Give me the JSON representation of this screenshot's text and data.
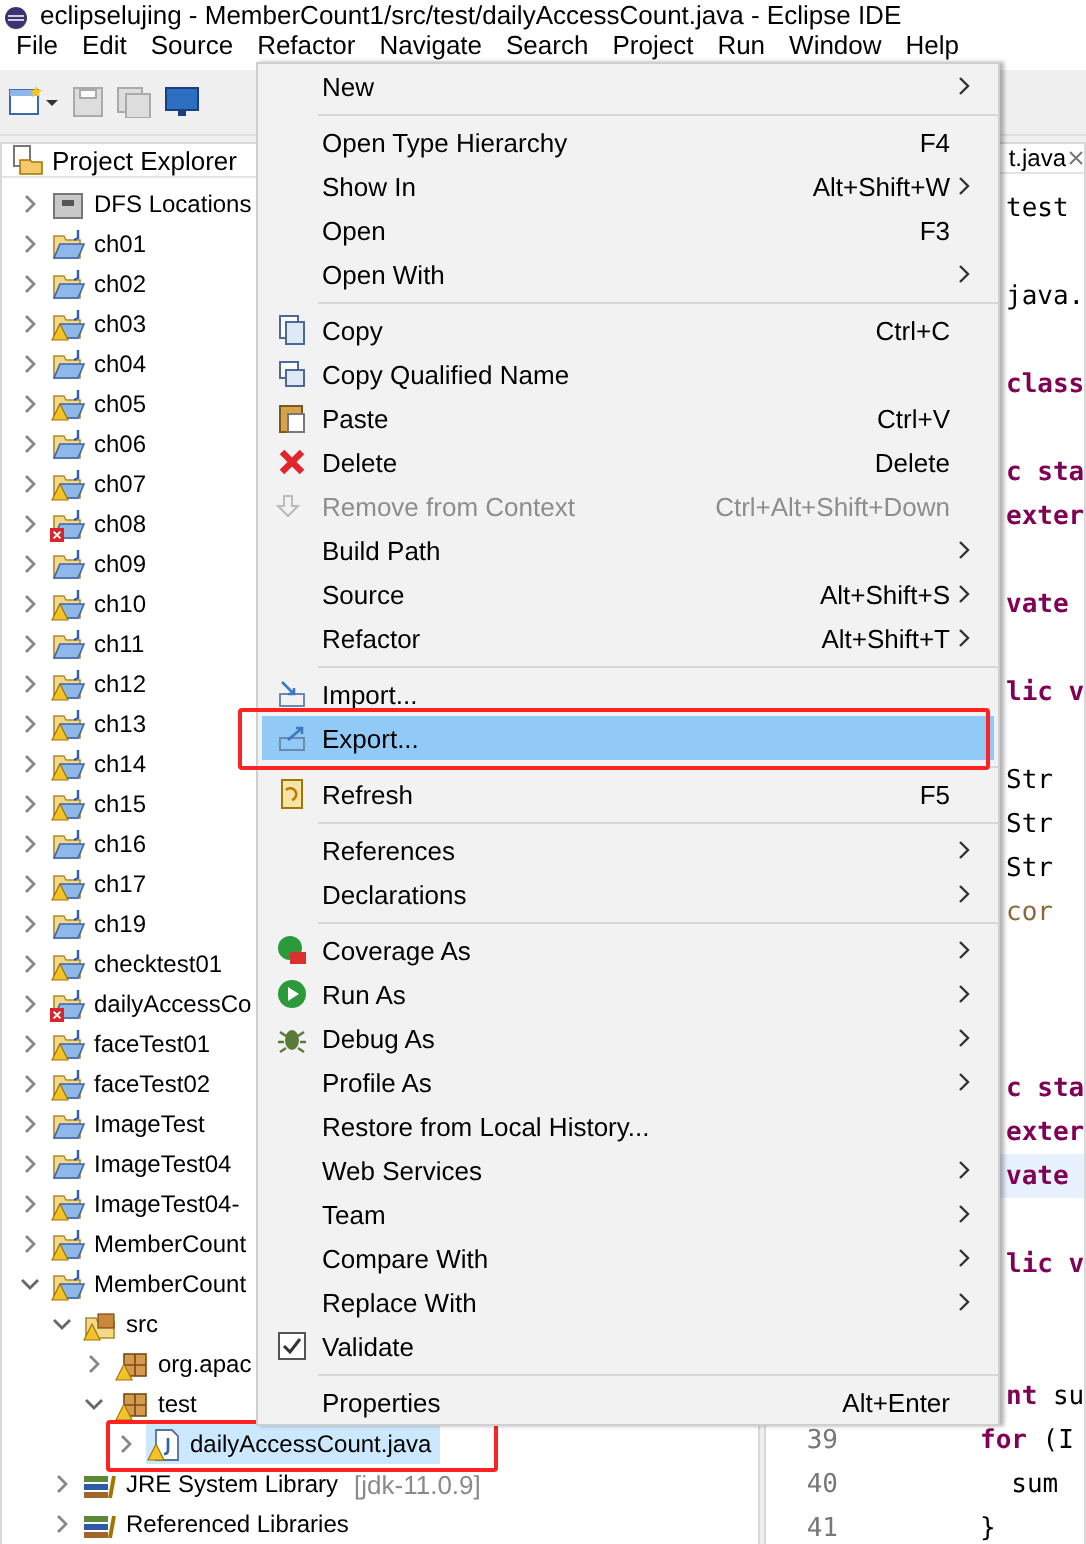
{
  "window": {
    "title": "eclipselujing - MemberCount1/src/test/dailyAccessCount.java - Eclipse IDE"
  },
  "menu_bar": [
    "File",
    "Edit",
    "Source",
    "Refactor",
    "Navigate",
    "Search",
    "Project",
    "Run",
    "Window",
    "Help"
  ],
  "explorer": {
    "title": "Project Explorer",
    "items": [
      {
        "label": "DFS Locations",
        "kind": "dfs",
        "warning": false,
        "error": false,
        "expanded": false,
        "selected": false,
        "outlined": false
      },
      {
        "label": "ch01",
        "kind": "project",
        "warning": false,
        "error": false,
        "expanded": false,
        "selected": false,
        "outlined": false
      },
      {
        "label": "ch02",
        "kind": "project",
        "warning": false,
        "error": false,
        "expanded": false,
        "selected": false,
        "outlined": false
      },
      {
        "label": "ch03",
        "kind": "project",
        "warning": true,
        "error": false,
        "expanded": false,
        "selected": false,
        "outlined": false
      },
      {
        "label": "ch04",
        "kind": "project",
        "warning": false,
        "error": false,
        "expanded": false,
        "selected": false,
        "outlined": false
      },
      {
        "label": "ch05",
        "kind": "project",
        "warning": true,
        "error": false,
        "expanded": false,
        "selected": false,
        "outlined": false
      },
      {
        "label": "ch06",
        "kind": "project",
        "warning": false,
        "error": false,
        "expanded": false,
        "selected": false,
        "outlined": false
      },
      {
        "label": "ch07",
        "kind": "project",
        "warning": true,
        "error": false,
        "expanded": false,
        "selected": false,
        "outlined": false
      },
      {
        "label": "ch08",
        "kind": "project",
        "warning": false,
        "error": true,
        "expanded": false,
        "selected": false,
        "outlined": false
      },
      {
        "label": "ch09",
        "kind": "project",
        "warning": false,
        "error": false,
        "expanded": false,
        "selected": false,
        "outlined": false
      },
      {
        "label": "ch10",
        "kind": "project",
        "warning": true,
        "error": false,
        "expanded": false,
        "selected": false,
        "outlined": false
      },
      {
        "label": "ch11",
        "kind": "project",
        "warning": false,
        "error": false,
        "expanded": false,
        "selected": false,
        "outlined": false
      },
      {
        "label": "ch12",
        "kind": "project",
        "warning": true,
        "error": false,
        "expanded": false,
        "selected": false,
        "outlined": false
      },
      {
        "label": "ch13",
        "kind": "project",
        "warning": true,
        "error": false,
        "expanded": false,
        "selected": false,
        "outlined": false
      },
      {
        "label": "ch14",
        "kind": "project",
        "warning": true,
        "error": false,
        "expanded": false,
        "selected": false,
        "outlined": false
      },
      {
        "label": "ch15",
        "kind": "project",
        "warning": true,
        "error": false,
        "expanded": false,
        "selected": false,
        "outlined": false
      },
      {
        "label": "ch16",
        "kind": "project",
        "warning": false,
        "error": false,
        "expanded": false,
        "selected": false,
        "outlined": false
      },
      {
        "label": "ch17",
        "kind": "project",
        "warning": true,
        "error": false,
        "expanded": false,
        "selected": false,
        "outlined": false
      },
      {
        "label": "ch19",
        "kind": "project",
        "warning": false,
        "error": false,
        "expanded": false,
        "selected": false,
        "outlined": false
      },
      {
        "label": "checktest01",
        "kind": "project",
        "warning": true,
        "error": false,
        "expanded": false,
        "selected": false,
        "outlined": false
      },
      {
        "label": "dailyAccessCo",
        "kind": "project",
        "warning": false,
        "error": true,
        "expanded": false,
        "selected": false,
        "outlined": false
      },
      {
        "label": "faceTest01",
        "kind": "project",
        "warning": true,
        "error": false,
        "expanded": false,
        "selected": false,
        "outlined": false
      },
      {
        "label": "faceTest02",
        "kind": "project",
        "warning": true,
        "error": false,
        "expanded": false,
        "selected": false,
        "outlined": false
      },
      {
        "label": "ImageTest",
        "kind": "project",
        "warning": false,
        "error": false,
        "expanded": false,
        "selected": false,
        "outlined": false
      },
      {
        "label": "ImageTest04",
        "kind": "project",
        "warning": false,
        "error": false,
        "expanded": false,
        "selected": false,
        "outlined": false
      },
      {
        "label": "ImageTest04-",
        "kind": "project",
        "warning": true,
        "error": false,
        "expanded": false,
        "selected": false,
        "outlined": false
      },
      {
        "label": "MemberCount",
        "kind": "project",
        "warning": true,
        "error": false,
        "expanded": false,
        "selected": false,
        "outlined": false
      },
      {
        "label": "MemberCount",
        "kind": "project",
        "warning": true,
        "error": false,
        "expanded": true,
        "selected": false,
        "outlined": false,
        "children": [
          {
            "label": "src",
            "kind": "source-folder",
            "warning": true,
            "error": false,
            "expanded": true,
            "selected": false,
            "outlined": false,
            "children": [
              {
                "label": "org.apac",
                "kind": "package",
                "warning": true,
                "error": false,
                "expanded": false,
                "selected": false,
                "outlined": false
              },
              {
                "label": "test",
                "kind": "package",
                "warning": true,
                "error": false,
                "expanded": true,
                "selected": false,
                "outlined": false,
                "children": [
                  {
                    "label": "dailyAccessCount.java",
                    "kind": "java-file",
                    "warning": true,
                    "error": false,
                    "expanded": false,
                    "selected": true,
                    "outlined": true
                  }
                ]
              }
            ]
          },
          {
            "label": "JRE System Library",
            "note": "[jdk-11.0.9]",
            "kind": "library",
            "warning": false,
            "error": false,
            "expanded": false,
            "selected": false,
            "outlined": false
          },
          {
            "label": "Referenced Libraries",
            "kind": "library",
            "warning": false,
            "error": false,
            "expanded": false,
            "selected": false,
            "outlined": false
          }
        ]
      }
    ]
  },
  "editor": {
    "tab": "t.java",
    "lines": [
      {
        "segments": [
          {
            "text": "test",
            "kind": "plain"
          }
        ],
        "current": false
      },
      {
        "current": false
      },
      {
        "segments": [
          {
            "text": "java.",
            "kind": "plain"
          }
        ],
        "current": false
      },
      {
        "current": false
      },
      {
        "segments": [
          {
            "text": "class",
            "kind": "keyword"
          }
        ],
        "current": false
      },
      {
        "current": false
      },
      {
        "segments": [
          {
            "text": "c sta",
            "kind": "keyword"
          }
        ],
        "current": false
      },
      {
        "segments": [
          {
            "text": "exter",
            "kind": "keyword"
          }
        ],
        "current": false
      },
      {
        "current": false
      },
      {
        "segments": [
          {
            "text": "vate",
            "kind": "keyword"
          }
        ],
        "current": false
      },
      {
        "current": false
      },
      {
        "segments": [
          {
            "text": "lic v",
            "kind": "keyword"
          }
        ],
        "current": false
      },
      {
        "current": false
      },
      {
        "segments": [
          {
            "text": "Str",
            "kind": "plain"
          }
        ],
        "current": false
      },
      {
        "segments": [
          {
            "text": "Str",
            "kind": "plain"
          }
        ],
        "current": false
      },
      {
        "segments": [
          {
            "text": "Str",
            "kind": "plain"
          }
        ],
        "current": false
      },
      {
        "segments": [
          {
            "text": "cor",
            "kind": "field"
          }
        ],
        "current": false
      },
      {
        "current": false
      },
      {
        "current": false
      },
      {
        "current": false
      },
      {
        "segments": [
          {
            "text": "c sta",
            "kind": "keyword"
          }
        ],
        "current": false
      },
      {
        "segments": [
          {
            "text": "exter",
            "kind": "keyword"
          }
        ],
        "current": false
      },
      {
        "segments": [
          {
            "text": "vate",
            "kind": "keyword"
          }
        ],
        "current": true
      },
      {
        "current": false
      },
      {
        "segments": [
          {
            "text": "lic v",
            "kind": "keyword"
          }
        ],
        "current": false
      },
      {
        "current": false
      },
      {
        "current": false
      },
      {
        "segments": [
          {
            "text": "nt",
            "kind": "keyword"
          },
          {
            "text": " su",
            "kind": "plain"
          }
        ],
        "current": false
      },
      {
        "number": "39",
        "segments": [
          {
            "text": "for",
            "kind": "keyword"
          },
          {
            "text": " (I",
            "kind": "plain"
          }
        ],
        "current": false
      },
      {
        "number": "40",
        "segments": [
          {
            "text": "  sum",
            "kind": "plain"
          }
        ],
        "current": false
      },
      {
        "number": "41",
        "segments": [
          {
            "text": "}",
            "kind": "plain"
          }
        ],
        "current": false
      }
    ]
  },
  "context_menu": [
    {
      "kind": "item",
      "label": "New",
      "submenu": true,
      "outlined": false,
      "selected": false
    },
    {
      "kind": "separator"
    },
    {
      "kind": "item",
      "label": "Open Type Hierarchy",
      "shortcut": "F4",
      "submenu": false,
      "outlined": false,
      "selected": false
    },
    {
      "kind": "item",
      "label": "Show In",
      "shortcut": "Alt+Shift+W",
      "submenu": true,
      "outlined": false,
      "selected": false
    },
    {
      "kind": "item",
      "label": "Open",
      "shortcut": "F3",
      "submenu": false,
      "outlined": false,
      "selected": false
    },
    {
      "kind": "item",
      "label": "Open With",
      "submenu": true,
      "outlined": false,
      "selected": false
    },
    {
      "kind": "separator"
    },
    {
      "kind": "item",
      "label": "Copy",
      "shortcut": "Ctrl+C",
      "submenu": false,
      "outlined": false,
      "selected": false
    },
    {
      "kind": "item",
      "label": "Copy Qualified Name",
      "submenu": false,
      "outlined": false,
      "selected": false
    },
    {
      "kind": "item",
      "label": "Paste",
      "shortcut": "Ctrl+V",
      "submenu": false,
      "outlined": false,
      "selected": false
    },
    {
      "kind": "item",
      "label": "Delete",
      "shortcut": "Delete",
      "submenu": false,
      "outlined": false,
      "selected": false
    },
    {
      "kind": "item",
      "label": "Remove from Context",
      "shortcut": "Ctrl+Alt+Shift+Down",
      "submenu": false,
      "disabled": true,
      "outlined": false,
      "selected": false
    },
    {
      "kind": "item",
      "label": "Build Path",
      "submenu": true,
      "outlined": false,
      "selected": false
    },
    {
      "kind": "item",
      "label": "Source",
      "shortcut": "Alt+Shift+S",
      "submenu": true,
      "outlined": false,
      "selected": false
    },
    {
      "kind": "item",
      "label": "Refactor",
      "shortcut": "Alt+Shift+T",
      "submenu": true,
      "outlined": false,
      "selected": false
    },
    {
      "kind": "separator"
    },
    {
      "kind": "item",
      "label": "Import...",
      "submenu": false,
      "outlined": false,
      "selected": false
    },
    {
      "kind": "item",
      "label": "Export...",
      "submenu": false,
      "outlined": true,
      "selected": true
    },
    {
      "kind": "separator"
    },
    {
      "kind": "item",
      "label": "Refresh",
      "shortcut": "F5",
      "submenu": false,
      "outlined": false,
      "selected": false
    },
    {
      "kind": "separator"
    },
    {
      "kind": "item",
      "label": "References",
      "submenu": true,
      "outlined": false,
      "selected": false
    },
    {
      "kind": "item",
      "label": "Declarations",
      "submenu": true,
      "outlined": false,
      "selected": false
    },
    {
      "kind": "separator"
    },
    {
      "kind": "item",
      "label": "Coverage As",
      "submenu": true,
      "outlined": false,
      "selected": false
    },
    {
      "kind": "item",
      "label": "Run As",
      "submenu": true,
      "outlined": false,
      "selected": false
    },
    {
      "kind": "item",
      "label": "Debug As",
      "submenu": true,
      "outlined": false,
      "selected": false
    },
    {
      "kind": "item",
      "label": "Profile As",
      "submenu": true,
      "outlined": false,
      "selected": false
    },
    {
      "kind": "item",
      "label": "Restore from Local History...",
      "submenu": false,
      "outlined": false,
      "selected": false
    },
    {
      "kind": "item",
      "label": "Web Services",
      "submenu": true,
      "outlined": false,
      "selected": false
    },
    {
      "kind": "item",
      "label": "Team",
      "submenu": true,
      "outlined": false,
      "selected": false
    },
    {
      "kind": "item",
      "label": "Compare With",
      "submenu": true,
      "outlined": false,
      "selected": false
    },
    {
      "kind": "item",
      "label": "Replace With",
      "submenu": true,
      "outlined": false,
      "selected": false
    },
    {
      "kind": "item",
      "label": "Validate",
      "submenu": false,
      "checked": true,
      "outlined": false,
      "selected": false
    },
    {
      "kind": "separator"
    },
    {
      "kind": "item",
      "label": "Properties",
      "shortcut": "Alt+Enter",
      "submenu": false,
      "outlined": false,
      "selected": false
    }
  ]
}
